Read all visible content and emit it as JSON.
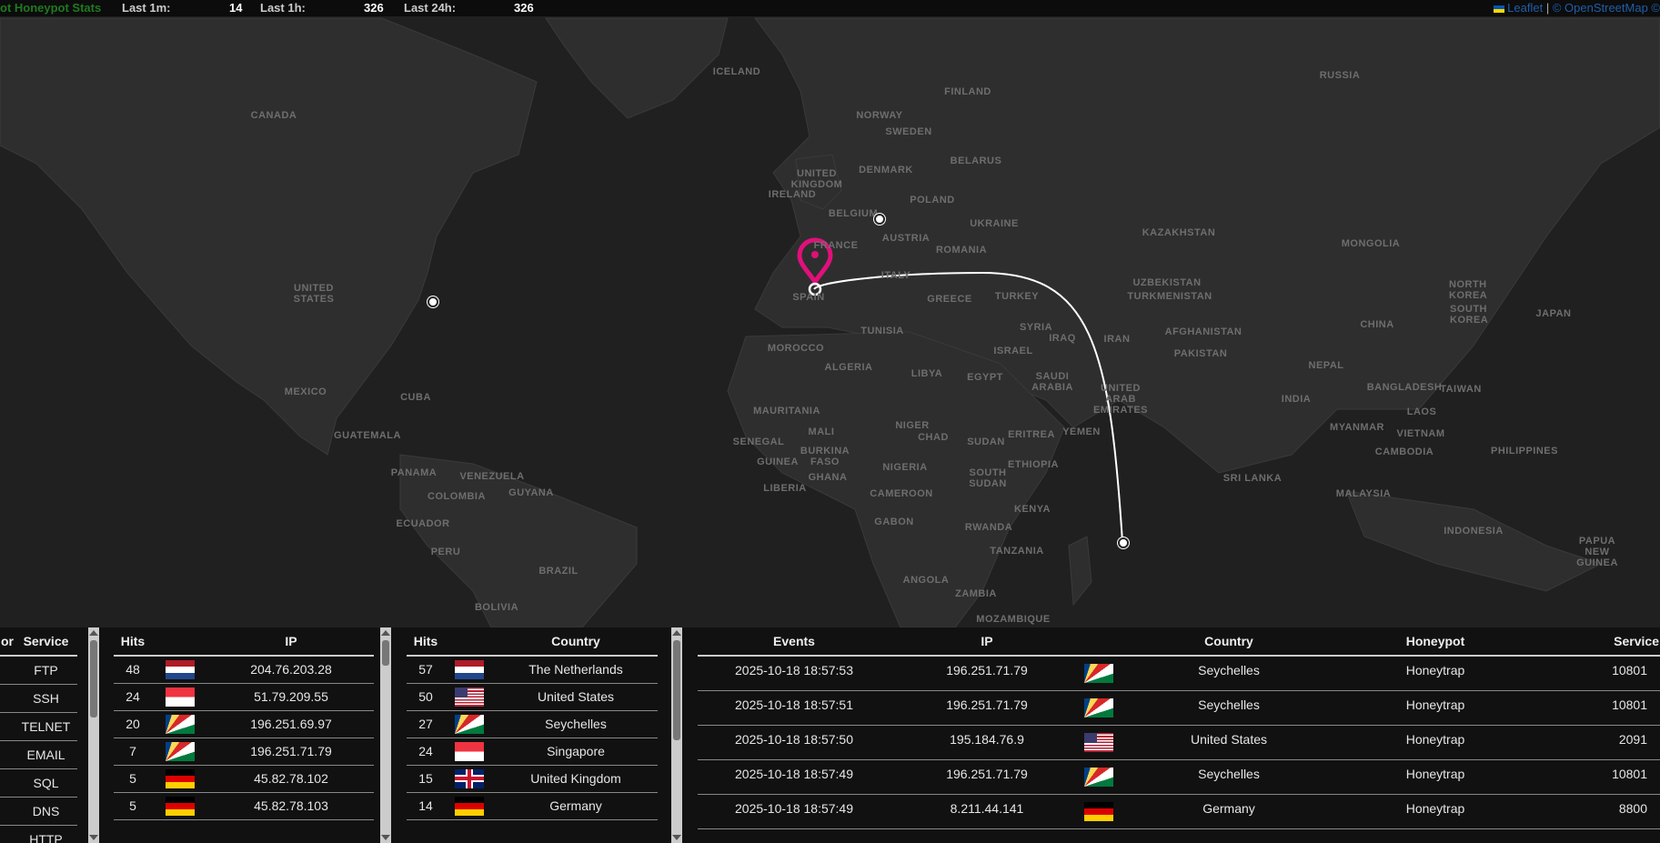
{
  "topbar": {
    "title": "ot Honeypot Stats",
    "last_1m_label": "Last 1m:",
    "last_1m_value": "14",
    "last_1h_label": "Last 1h:",
    "last_1h_value": "326",
    "last_24h_label": "Last 24h:",
    "last_24h_value": "326",
    "attribution_leaflet": "Leaflet",
    "attribution_sep": "|",
    "attribution_osm": "© OpenStreetMap ©"
  },
  "map": {
    "labels": [
      "ICELAND",
      "RUSSIA",
      "CANADA",
      "FINLAND",
      "NORWAY",
      "SWEDEN",
      "UNITED KINGDOM",
      "IRELAND",
      "DENMARK",
      "BELARUS",
      "POLAND",
      "BELGIUM",
      "UKRAINE",
      "FRANCE",
      "AUSTRIA",
      "ROMANIA",
      "KAZAKHSTAN",
      "MONGOLIA",
      "UNITED STATES",
      "ITALY",
      "SPAIN",
      "GREECE",
      "TURKEY",
      "UZBEKISTAN",
      "TURKMENISTAN",
      "NORTH KOREA",
      "SOUTH KOREA",
      "JAPAN",
      "SYRIA",
      "IRAQ",
      "IRAN",
      "AFGHANISTAN",
      "CHINA",
      "TUNISIA",
      "ISRAEL",
      "PAKISTAN",
      "MOROCCO",
      "ALGERIA",
      "LIBYA",
      "EGYPT",
      "SAUDI ARABIA",
      "NEPAL",
      "BANGLADESH",
      "MEXICO",
      "INDIA",
      "UNITED ARAB EMIRATES",
      "TAIWAN",
      "CUBA",
      "MAURITANIA",
      "MALI",
      "NIGER",
      "CHAD",
      "SUDAN",
      "ERITREA",
      "YEMEN",
      "MYANMAR",
      "LAOS",
      "GUATEMALA",
      "SENEGAL",
      "VIETNAM",
      "PHILIPPINES",
      "BURKINA FASO",
      "GUINEA",
      "NIGERIA",
      "ETHIOPIA",
      "CAMBODIA",
      "PANAMA",
      "VENEZUELA",
      "GHANA",
      "LIBERIA",
      "SOUTH SUDAN",
      "SRI LANKA",
      "GUYANA",
      "COLOMBIA",
      "CAMEROON",
      "MALAYSIA",
      "ECUADOR",
      "GABON",
      "KENYA",
      "RWANDA",
      "INDONESIA",
      "PAPUA NEW GUINEA",
      "PERU",
      "TANZANIA",
      "BRAZIL",
      "ANGOLA",
      "ZAMBIA",
      "BOLIVIA",
      "MOZAMBIQUE"
    ],
    "marker_color": "#e0107a"
  },
  "service_panel": {
    "col_port": "or",
    "col_service": "Service",
    "services": [
      "FTP",
      "SSH",
      "TELNET",
      "EMAIL",
      "SQL",
      "DNS",
      "HTTP"
    ]
  },
  "ip_panel": {
    "col_hits": "Hits",
    "col_ip": "IP",
    "rows": [
      {
        "hits": "48",
        "flag": "nl",
        "ip": "204.76.203.28"
      },
      {
        "hits": "24",
        "flag": "sg",
        "ip": "51.79.209.55"
      },
      {
        "hits": "20",
        "flag": "sc",
        "ip": "196.251.69.97"
      },
      {
        "hits": "7",
        "flag": "sc",
        "ip": "196.251.71.79"
      },
      {
        "hits": "5",
        "flag": "de",
        "ip": "45.82.78.102"
      },
      {
        "hits": "5",
        "flag": "de",
        "ip": "45.82.78.103"
      }
    ]
  },
  "country_panel": {
    "col_hits": "Hits",
    "col_country": "Country",
    "rows": [
      {
        "hits": "57",
        "flag": "nl",
        "country": "The Netherlands"
      },
      {
        "hits": "50",
        "flag": "us",
        "country": "United States"
      },
      {
        "hits": "27",
        "flag": "sc",
        "country": "Seychelles"
      },
      {
        "hits": "24",
        "flag": "sg",
        "country": "Singapore"
      },
      {
        "hits": "15",
        "flag": "gb",
        "country": "United Kingdom"
      },
      {
        "hits": "14",
        "flag": "de",
        "country": "Germany"
      }
    ]
  },
  "events_panel": {
    "col_events": "Events",
    "col_ip": "IP",
    "col_country": "Country",
    "col_honeypot": "Honeypot",
    "col_service": "Service",
    "rows": [
      {
        "time": "2025-10-18 18:57:53",
        "ip": "196.251.71.79",
        "flag": "sc",
        "country": "Seychelles",
        "honeypot": "Honeytrap",
        "service": "10801"
      },
      {
        "time": "2025-10-18 18:57:51",
        "ip": "196.251.71.79",
        "flag": "sc",
        "country": "Seychelles",
        "honeypot": "Honeytrap",
        "service": "10801"
      },
      {
        "time": "2025-10-18 18:57:50",
        "ip": "195.184.76.9",
        "flag": "us",
        "country": "United States",
        "honeypot": "Honeytrap",
        "service": "2091"
      },
      {
        "time": "2025-10-18 18:57:49",
        "ip": "196.251.71.79",
        "flag": "sc",
        "country": "Seychelles",
        "honeypot": "Honeytrap",
        "service": "10801"
      },
      {
        "time": "2025-10-18 18:57:49",
        "ip": "8.211.44.141",
        "flag": "de",
        "country": "Germany",
        "honeypot": "Honeytrap",
        "service": "8800"
      }
    ]
  }
}
